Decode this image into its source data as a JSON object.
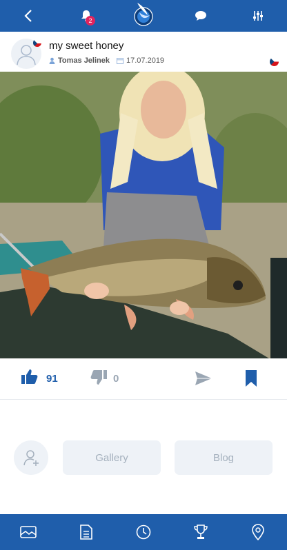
{
  "header": {
    "notifications_count": "2",
    "icons": [
      "back-icon",
      "bell-icon",
      "app-logo",
      "chat-icon",
      "filter-icon"
    ]
  },
  "post": {
    "title": "my sweet honey",
    "author": "Tomas Jelinek",
    "date": "17.07.2019",
    "country_flag": "Czech Republic"
  },
  "actions": {
    "likes": "91",
    "dislikes": "0"
  },
  "profile_actions": {
    "gallery_label": "Gallery",
    "blog_label": "Blog"
  },
  "colors": {
    "brand_blue": "#1f5eab",
    "muted": "#9aa6b3",
    "pill_bg": "#eef2f7"
  },
  "bottom_nav": [
    "gallery-icon",
    "document-icon",
    "clock-icon",
    "trophy-icon",
    "location-icon"
  ]
}
